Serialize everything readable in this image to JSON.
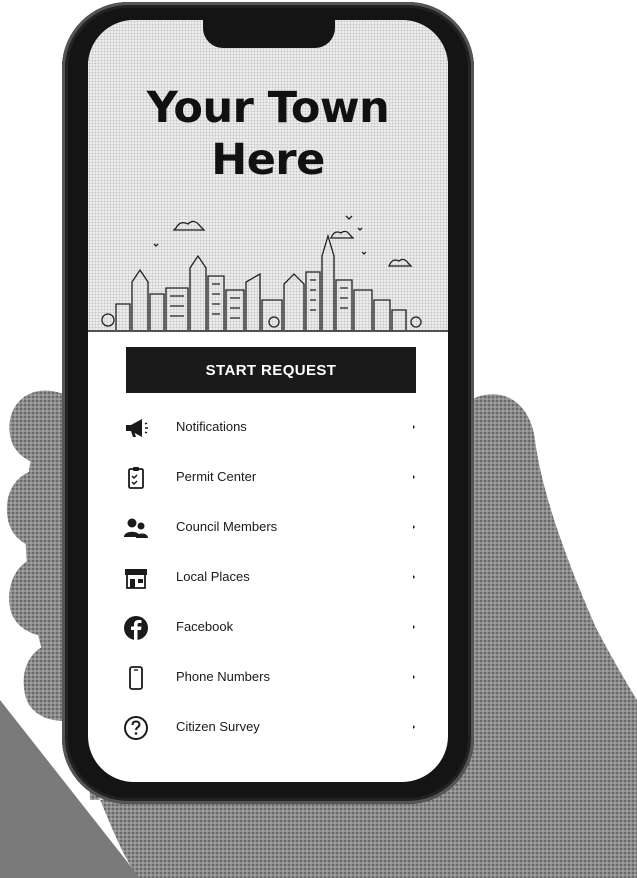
{
  "hero": {
    "title_line1": "Your Town",
    "title_line2": "Here"
  },
  "start_request": {
    "label": "START REQUEST"
  },
  "menu": {
    "items": [
      {
        "label": "Notifications",
        "icon": "megaphone-icon"
      },
      {
        "label": "Permit Center",
        "icon": "clipboard-check-icon"
      },
      {
        "label": "Council Members",
        "icon": "people-icon"
      },
      {
        "label": "Local Places",
        "icon": "storefront-icon"
      },
      {
        "label": "Facebook",
        "icon": "facebook-icon"
      },
      {
        "label": "Phone Numbers",
        "icon": "phone-icon"
      },
      {
        "label": "Citizen Survey",
        "icon": "question-circle-icon"
      }
    ]
  },
  "colors": {
    "button_background": "#1a1a1a",
    "button_text": "#ffffff",
    "hero_background": "#ececec",
    "text": "#1a1a1a"
  }
}
